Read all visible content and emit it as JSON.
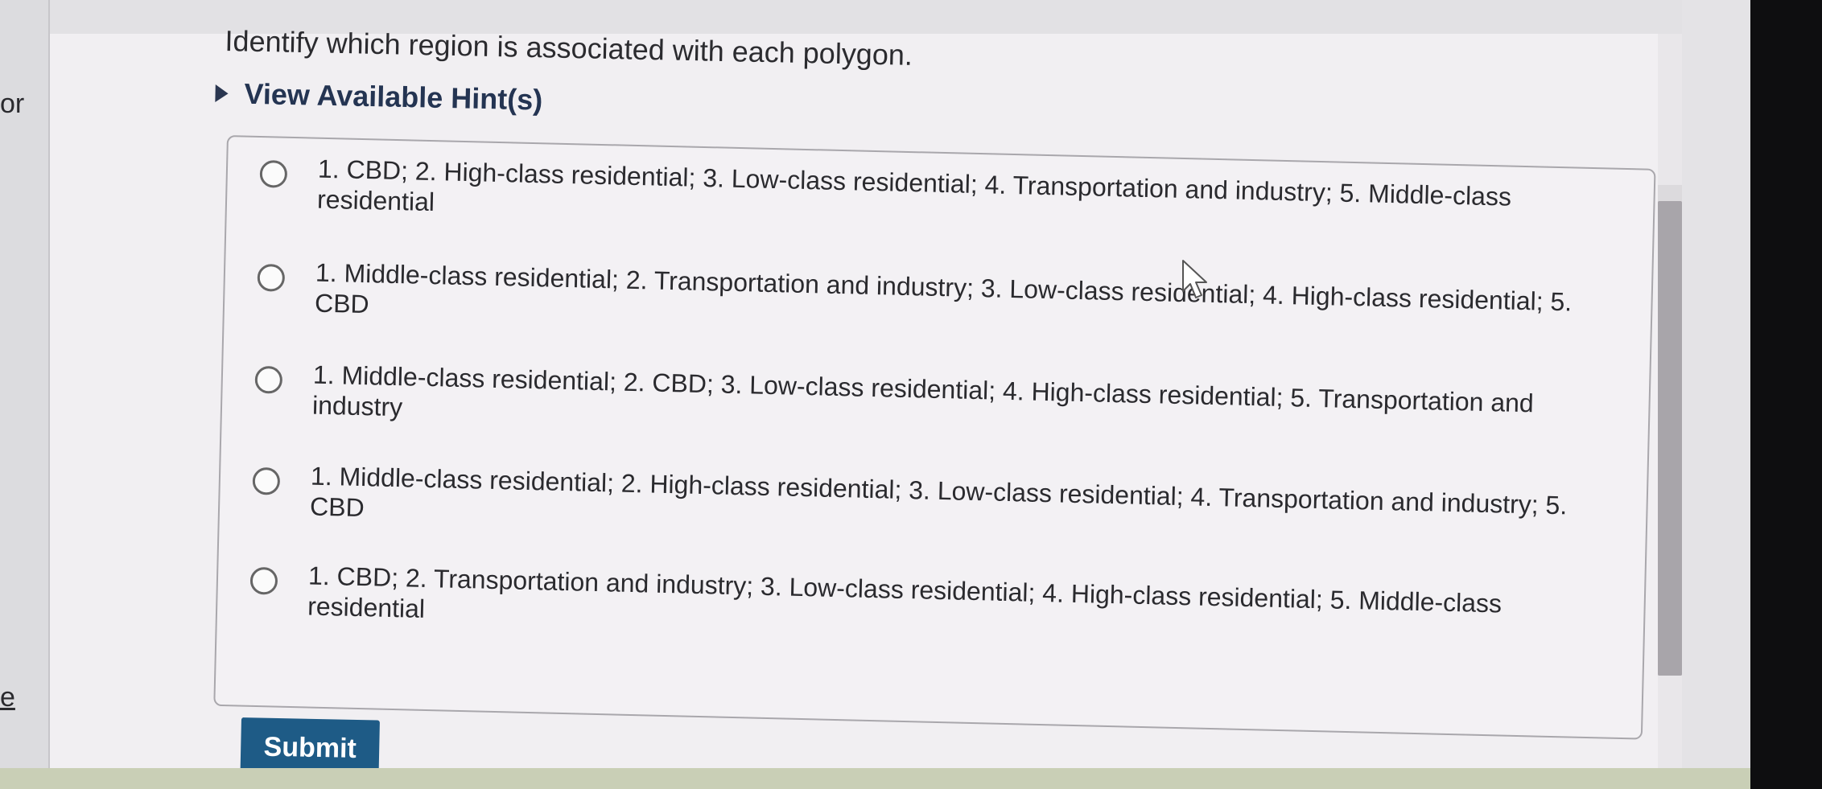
{
  "sidebar": {
    "fragment_top": "or",
    "fragment_bottom": "e"
  },
  "question": {
    "prompt": "Identify which region is associated with each polygon.",
    "hint_label": "View Available Hint(s)"
  },
  "options": [
    {
      "label": "1. CBD; 2. High-class residential; 3. Low-class residential; 4. Transportation and industry; 5. Middle-class residential"
    },
    {
      "label": "1. Middle-class residential; 2. Transportation and industry; 3. Low-class residential; 4. High-class residential; 5. CBD"
    },
    {
      "label": "1. Middle-class residential; 2. CBD; 3. Low-class residential; 4. High-class residential; 5. Transportation and industry"
    },
    {
      "label": "1. Middle-class residential; 2. High-class residential; 3. Low-class residential; 4. Transportation and industry; 5. CBD"
    },
    {
      "label": "1. CBD; 2. Transportation and industry; 3. Low-class residential; 4. High-class residential; 5. Middle-class residential"
    }
  ],
  "actions": {
    "submit_label": "Submit"
  },
  "colors": {
    "submit_bg": "#1e5b86",
    "hint_text": "#243452"
  }
}
